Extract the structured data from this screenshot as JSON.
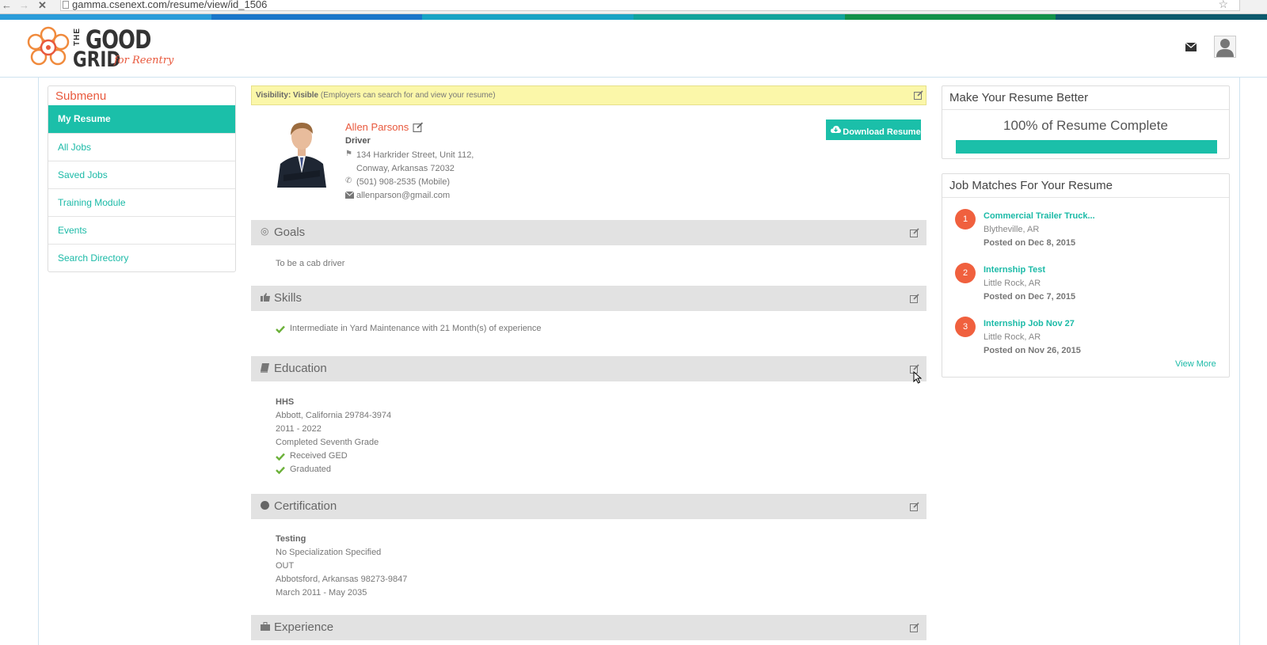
{
  "browser": {
    "url": "gamma.csenext.com/resume/view/id_1506"
  },
  "stripe_colors": [
    "#2b9cd9",
    "#1a76c9",
    "#18a3c4",
    "#13a39b",
    "#13914a",
    "#0d5a6d"
  ],
  "brand": {
    "the": "THE",
    "good": "GOOD",
    "grid": "GRID",
    "tagline": "for Reentry"
  },
  "colors": {
    "accent": "#1bbfa9",
    "brand_orange": "#e8583c",
    "badge": "#f0603e",
    "visibility_bg": "#fbf7a9",
    "section_bg": "#e2e2e2"
  },
  "submenu": {
    "title": "Submenu",
    "items": [
      {
        "label": "My Resume",
        "active": true
      },
      {
        "label": "All Jobs"
      },
      {
        "label": "Saved Jobs"
      },
      {
        "label": "Training Module"
      },
      {
        "label": "Events"
      },
      {
        "label": "Search Directory"
      }
    ]
  },
  "visibility": {
    "label": "Visibility: Visible",
    "note": "(Employers can search for and view your resume)"
  },
  "profile": {
    "name": "Allen Parsons",
    "title": "Driver",
    "address1": "134 Harkrider Street, Unit 112,",
    "address2": "Conway, Arkansas  72032",
    "phone": "(501) 908-2535 (Mobile)",
    "email": "allenparson@gmail.com",
    "download_label": "Download Resume"
  },
  "sections": {
    "goals": {
      "title": "Goals",
      "text": "To be a cab driver"
    },
    "skills": {
      "title": "Skills",
      "item": "Intermediate in Yard Maintenance with 21  Month(s) of experience"
    },
    "education": {
      "title": "Education",
      "school": "HHS",
      "location": "Abbott, California  29784-3974",
      "years": "2011 - 2022",
      "level": "Completed Seventh Grade",
      "check1": "Received GED",
      "check2": "Graduated"
    },
    "certification": {
      "title": "Certification",
      "name": "Testing",
      "specialization": "No Specialization Specified",
      "org": "OUT",
      "location": "Abbotsford, Arkansas  98273-9847",
      "dates": "March 2011 - May 2035"
    },
    "experience": {
      "title": "Experience"
    }
  },
  "resume_score": {
    "title": "Make Your Resume Better",
    "label": "100% of Resume Complete",
    "percent": 100
  },
  "job_matches": {
    "title": "Job Matches For Your Resume",
    "items": [
      {
        "num": "1",
        "title": "Commercial Trailer Truck...",
        "location": "Blytheville, AR",
        "date": "Posted on Dec 8, 2015"
      },
      {
        "num": "2",
        "title": "Internship Test",
        "location": "Little Rock, AR",
        "date": "Posted on Dec 7, 2015"
      },
      {
        "num": "3",
        "title": "Internship Job Nov 27",
        "location": "Little Rock, AR",
        "date": "Posted on Nov 26, 2015"
      }
    ],
    "view_more": "View More"
  }
}
